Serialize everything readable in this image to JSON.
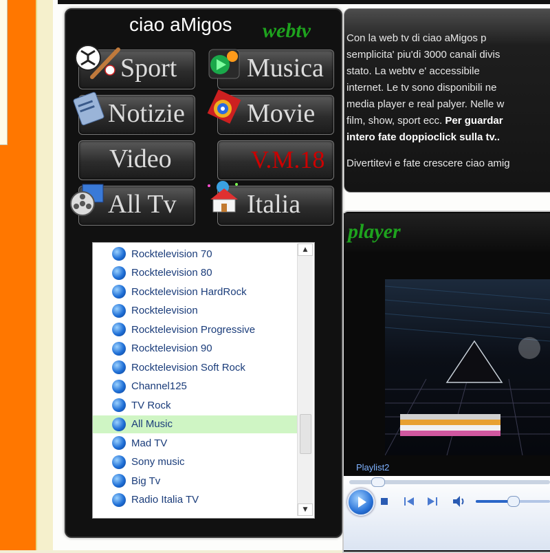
{
  "header": {
    "title": "ciao aMigos",
    "title_accent": "webtv"
  },
  "categories": [
    {
      "label": "Sport",
      "icon": "sport-icon"
    },
    {
      "label": "Musica",
      "icon": "music-icon"
    },
    {
      "label": "Notizie",
      "icon": "news-icon"
    },
    {
      "label": "Movie",
      "icon": "movie-icon"
    },
    {
      "label": "Video",
      "icon": ""
    },
    {
      "label": "V.M.18",
      "icon": "",
      "color": "#cc0000"
    },
    {
      "label": "All Tv",
      "icon": "film-reel-icon"
    },
    {
      "label": "Italia",
      "icon": "house-icon"
    }
  ],
  "channels": {
    "items": [
      "Rocktelevision 70",
      "Rocktelevision 80",
      "Rocktelevision HardRock",
      "Rocktelevision",
      "Rocktelevision Progressive",
      "Rocktelevision 90",
      "Rocktelevision Soft Rock",
      "Channel125",
      "TV Rock",
      "All Music",
      "Mad TV",
      "Sony music",
      "Big Tv",
      "Radio Italia TV"
    ],
    "selected": "All Music",
    "scroll_up": "▲",
    "scroll_down": "▼"
  },
  "info": {
    "lines": [
      "Con la web tv di ciao aMigos p",
      "semplicita' piu'di 3000 canali divis",
      "stato. La webtv e' accessibile",
      "internet. Le tv sono disponibili ne",
      "media player e real palyer. Nelle w",
      "film, show, sport ecc."
    ],
    "bold_part": " Per guardar",
    "bold_line2": "intero fate doppioclick sulla tv..",
    "footer": "Divertitevi e fate crescere ciao amig"
  },
  "player": {
    "label": "player",
    "playlist_label": "Playlist2",
    "seek_progress": 0.11,
    "volume": 0.5
  },
  "colors": {
    "accent": "#1ea31e",
    "sidebar": "#ff7700",
    "vm18": "#cc0000"
  }
}
